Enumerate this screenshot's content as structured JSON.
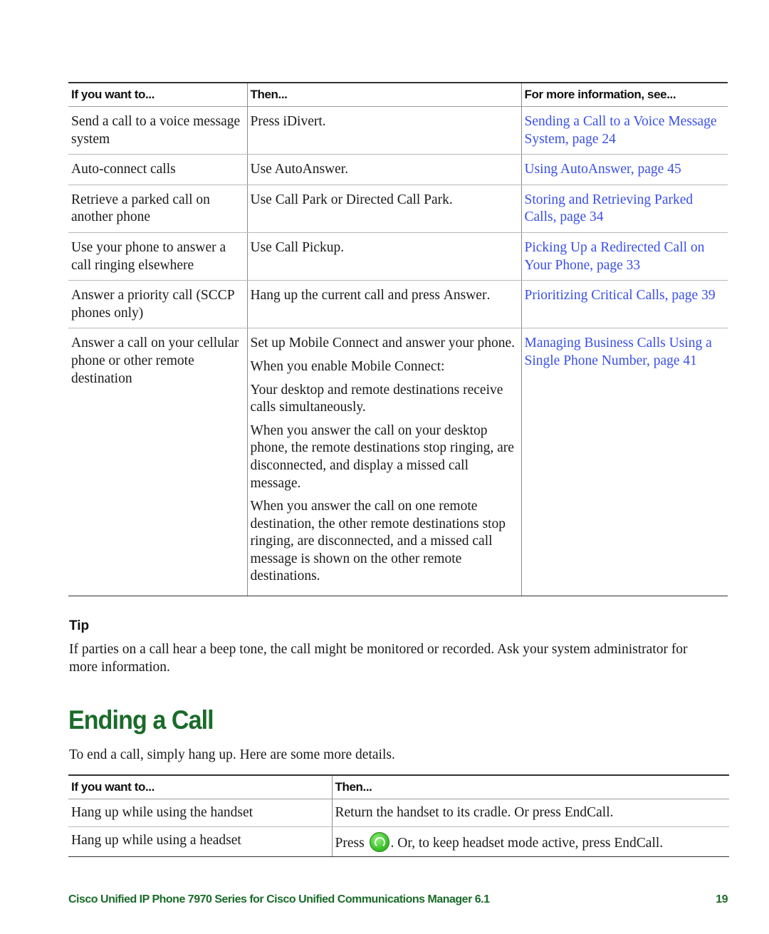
{
  "table1": {
    "headers": [
      "If you want to...",
      "Then...",
      "For more information, see..."
    ],
    "rows": [
      {
        "want": "Send a call to a voice message system",
        "then": [
          {
            "pre": "Press ",
            "kw": "iDivert",
            "post": "."
          }
        ],
        "see": "Sending a Call to a Voice Message System, page 24"
      },
      {
        "want": "Auto-connect calls",
        "then": [
          {
            "pre": "Use AutoAnswer.",
            "kw": "",
            "post": ""
          }
        ],
        "see": "Using AutoAnswer, page 45"
      },
      {
        "want": "Retrieve a parked call on another phone",
        "then": [
          {
            "pre": "Use Call Park or Directed Call Park.",
            "kw": "",
            "post": ""
          }
        ],
        "see": "Storing and Retrieving Parked Calls, page 34"
      },
      {
        "want": "Use your phone to answer a call ringing elsewhere",
        "then": [
          {
            "pre": "Use Call Pickup.",
            "kw": "",
            "post": ""
          }
        ],
        "see": "Picking Up a Redirected Call on Your Phone, page 33"
      },
      {
        "want": "Answer a priority call (SCCP phones only)",
        "then": [
          {
            "pre": "Hang up the current call and press ",
            "kw": "Answer",
            "post": "."
          }
        ],
        "see": "Prioritizing Critical Calls, page 39"
      },
      {
        "want": "Answer a call on your cellular phone or other remote destination",
        "then": [
          {
            "pre": "Set up Mobile Connect and answer your phone.",
            "kw": "",
            "post": ""
          },
          {
            "pre": "When you enable Mobile Connect:",
            "kw": "",
            "post": ""
          },
          {
            "pre": "Your desktop and remote destinations receive calls simultaneously.",
            "kw": "",
            "post": ""
          },
          {
            "pre": "When you answer the call on your desktop phone, the remote destinations stop ringing, are disconnected, and display a missed call message.",
            "kw": "",
            "post": ""
          },
          {
            "pre": "When you answer the call on one remote destination, the other remote destinations stop ringing, are disconnected, and a missed call message is shown on the other remote destinations.",
            "kw": "",
            "post": ""
          }
        ],
        "see": "Managing Business Calls Using a Single Phone Number, page 41"
      }
    ]
  },
  "tip": {
    "title": "Tip",
    "body": "If parties on a call hear a beep tone, the call might be monitored or recorded. Ask your system administrator for more information."
  },
  "section": {
    "title": "Ending a Call",
    "intro": "To end a call, simply hang up. Here are some more details."
  },
  "table2": {
    "headers": [
      "If you want to...",
      "Then..."
    ],
    "rows": [
      {
        "want": "Hang up while using the handset",
        "pre": "Return the handset to its cradle. Or press ",
        "kw": "EndCall",
        "post": "."
      },
      {
        "want": "Hang up while using a headset",
        "pre": "Press ",
        "icon": "headset-icon",
        "mid": ". Or, to keep headset mode active, press ",
        "kw": "EndCall",
        "post": "."
      }
    ]
  },
  "footer": {
    "title": "Cisco Unified IP Phone 7970 Series for Cisco Unified Communications Manager 6.1",
    "page": "19"
  },
  "colors": {
    "heading": "#1b6b2a",
    "link": "#3a4fe8"
  }
}
